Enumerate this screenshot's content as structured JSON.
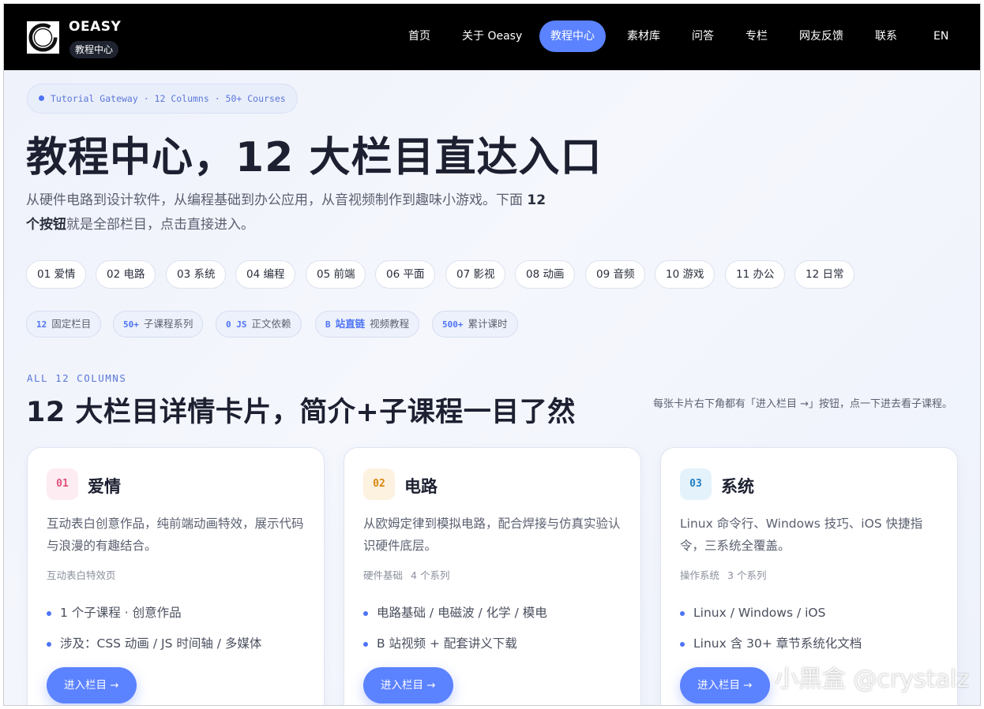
{
  "header": {
    "brand_title": "OEASY",
    "brand_badge": "教程中心",
    "nav": [
      {
        "label": "首页",
        "active": false
      },
      {
        "label": "关于 Oeasy",
        "active": false
      },
      {
        "label": "教程中心",
        "active": true
      },
      {
        "label": "素材库",
        "active": false
      },
      {
        "label": "问答",
        "active": false
      },
      {
        "label": "专栏",
        "active": false
      },
      {
        "label": "网友反馈",
        "active": false
      },
      {
        "label": "联系",
        "active": false
      },
      {
        "label": "EN",
        "active": false
      }
    ]
  },
  "hero": {
    "kicker": "Tutorial Gateway · 12 Columns · 50+ Courses",
    "title": "教程中心，12 大栏目直达入口",
    "desc_part1": "从硬件电路到设计软件，从编程基础到办公应用，从音视频制作到趣味小游戏。下面 ",
    "desc_bold": "12 个按钮",
    "desc_part2": "就是全部栏目，点击直接进入。",
    "chips": [
      "01 爱情",
      "02 电路",
      "03 系统",
      "04 编程",
      "05 前端",
      "06 平面",
      "07 影视",
      "08 动画",
      "09 音频",
      "10 游戏",
      "11 办公",
      "12 日常"
    ],
    "stats": [
      {
        "num": "12",
        "label": "固定栏目"
      },
      {
        "num": "50+",
        "label": "子课程系列"
      },
      {
        "num": "0 JS",
        "label": "正文依赖"
      },
      {
        "num": "B",
        "highlight": "站直链",
        "label": "视频教程"
      },
      {
        "num": "500+",
        "label": "累计课时"
      }
    ]
  },
  "section": {
    "kicker": "ALL 12 COLUMNS",
    "title": "12 大栏目详情卡片，简介+子课程一目了然",
    "note": "每张卡片右下角都有「进入栏目 →」按钮，点一下进去看子课程。"
  },
  "cards": [
    {
      "num": "01",
      "title": "爱情",
      "num_color": "#e0507a",
      "num_bg": "#fdecf1",
      "desc": "互动表白创意作品，纯前端动画特效，展示代码与浪漫的有趣结合。",
      "meta": [
        "互动表白特效页"
      ],
      "items": [
        "1 个子课程 · 创意作品",
        "涉及：CSS 动画 / JS 时间轴 / 多媒体"
      ],
      "button": "进入栏目 →"
    },
    {
      "num": "02",
      "title": "电路",
      "num_color": "#d9860f",
      "num_bg": "#fdf1e0",
      "desc": "从欧姆定律到模拟电路，配合焊接与仿真实验认识硬件底层。",
      "meta": [
        "硬件基础",
        "4 个系列"
      ],
      "items": [
        "电路基础 / 电磁波 / 化学 / 模电",
        "B 站视频 + 配套讲义下载"
      ],
      "button": "进入栏目 →"
    },
    {
      "num": "03",
      "title": "系统",
      "num_color": "#1f7fc4",
      "num_bg": "#e4f2fb",
      "desc": "Linux 命令行、Windows 技巧、iOS 快捷指令，三系统全覆盖。",
      "meta": [
        "操作系统",
        "3 个系列"
      ],
      "items": [
        "Linux / Windows / iOS",
        "Linux 含 30+ 章节系统化文档"
      ],
      "button": "进入栏目 →"
    }
  ],
  "watermark": "小黑盒 @crystalz"
}
